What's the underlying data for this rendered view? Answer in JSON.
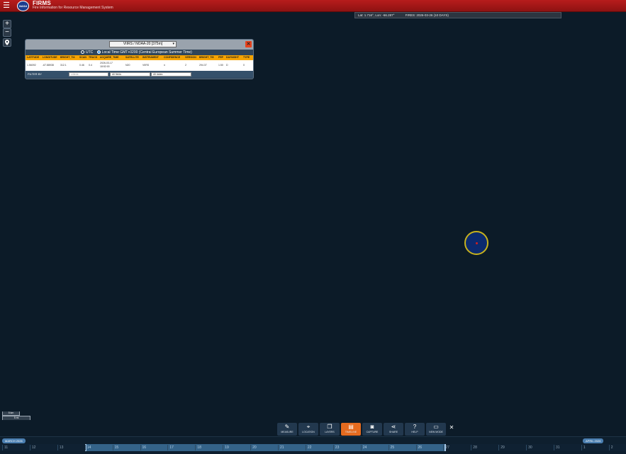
{
  "header": {
    "title": "FIRMS",
    "subtitle": "Fire Information for Resource Management System",
    "logo_text": "NASA"
  },
  "coordinates": {
    "latlon": "Lat: 1.716°, Lon: -66.287°",
    "fires": "FIRES: 2026-03-26 (10 DAYS)"
  },
  "map_controls": {
    "zoom_in": "+",
    "zoom_out": "−",
    "locate": "⬤"
  },
  "popup": {
    "layer_select": "VIIRS / NOAA-20 [375m]",
    "time_options": {
      "utc": "UTC",
      "local": "Local Time GMT+0200 (Central European Summer Time)",
      "selected": "local"
    },
    "columns": [
      "LATITUDE",
      "LONGITUDE",
      "BRIGHT_TI4",
      "SCAN",
      "TRACK",
      "ACQUIRE_TIME",
      "SATELLITE",
      "INSTRUMENT",
      "CONFIDENCE",
      "VERSION",
      "BRIGHT_TI5",
      "FRP",
      "DAYNIGHT",
      "TYPE"
    ],
    "row": {
      "latitude": "1.56092",
      "longitude": "-67.88938",
      "bright_ti4": "312.1",
      "scan": "0.46",
      "track": "0.4",
      "acquire_date": "2026-03-17",
      "acquire_clock": "18:52:00",
      "satellite": "N20",
      "instrument": "VIIRS",
      "confidence": "n",
      "version": "2",
      "bright_ti5": "294.37",
      "frp": "1.50",
      "daynight": "D",
      "type": "0"
    },
    "filter": {
      "label": "FILTER BY",
      "placeholder": "criteria",
      "select1": "All fields",
      "select2": "All dates"
    }
  },
  "scale": {
    "km": "5 km",
    "mi": "5 mi"
  },
  "toolbar": {
    "tools": [
      {
        "label": "MEASURE",
        "icon": "ruler-icon",
        "glyph": "✎",
        "active": false
      },
      {
        "label": "LOCATION",
        "icon": "pin-icon",
        "glyph": "⌖",
        "active": false
      },
      {
        "label": "LAYERS",
        "icon": "layers-icon",
        "glyph": "❐",
        "active": false
      },
      {
        "label": "TIMELINE",
        "icon": "timeline-icon",
        "glyph": "▤",
        "active": true
      },
      {
        "label": "CAPTURE",
        "icon": "camera-icon",
        "glyph": "◙",
        "active": false
      },
      {
        "label": "SHARE",
        "icon": "share-icon",
        "glyph": "⋖",
        "active": false
      },
      {
        "label": "HELP",
        "icon": "help-icon",
        "glyph": "?",
        "active": false
      },
      {
        "label": "NEW MODE",
        "icon": "monitor-icon",
        "glyph": "▭",
        "active": false
      }
    ],
    "close": "✕"
  },
  "timeline": {
    "month_start": "MARCH 2026",
    "month_end": "APRIL 2026",
    "days": [
      "11",
      "12",
      "13",
      "14",
      "15",
      "16",
      "17",
      "18",
      "19",
      "20",
      "21",
      "22",
      "23",
      "24",
      "25",
      "26",
      "27",
      "28",
      "29",
      "30",
      "31",
      "1",
      "2"
    ],
    "selected_range": [
      "14",
      "26"
    ]
  },
  "colors": {
    "header": "#b71c1c",
    "map_background": "#0c1b28",
    "column_header": "#f5a300",
    "active_tool": "#e56b1f",
    "fire_ring": "#c8b21d"
  }
}
